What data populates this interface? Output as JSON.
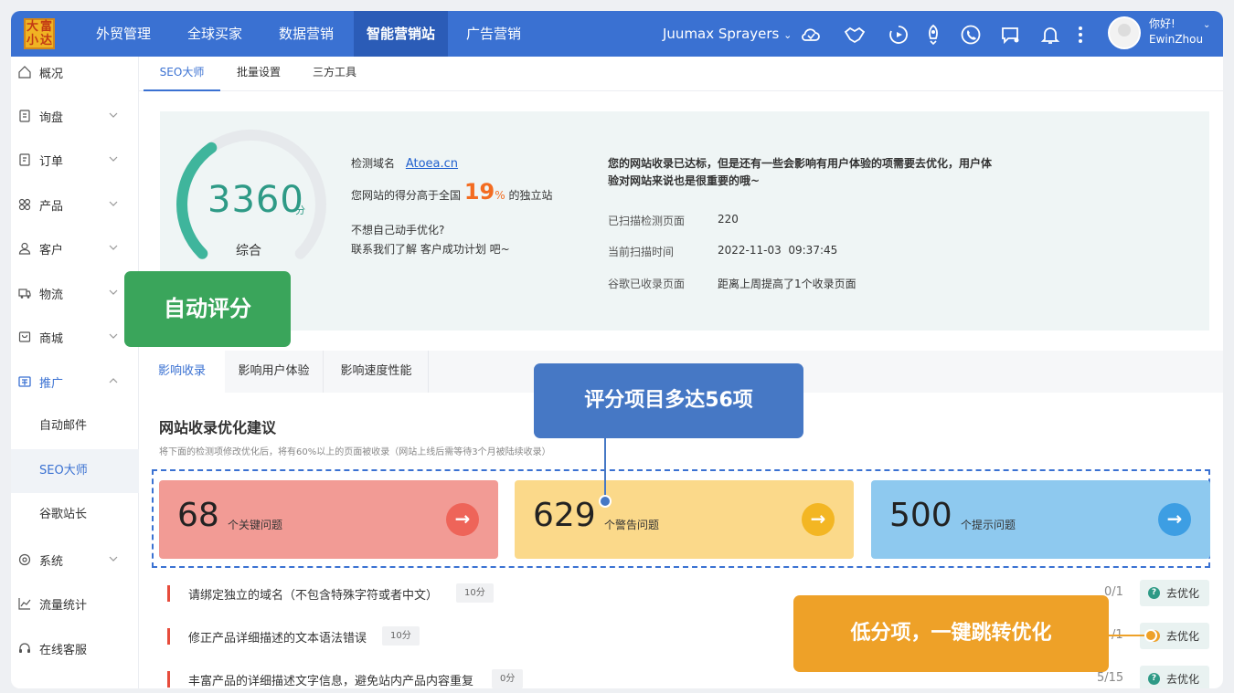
{
  "brand": {
    "logo_chars": [
      "大",
      "富",
      "小",
      "达"
    ]
  },
  "nav": {
    "items": [
      "外贸管理",
      "全球买家",
      "数据营销",
      "智能营销站",
      "广告营销"
    ]
  },
  "header": {
    "company": "Juumax Sprayers",
    "greeting": "你好!",
    "username": "EwinZhou",
    "icons": [
      "cloud-icon",
      "handshake-icon",
      "play-icon",
      "rocket-icon",
      "phone-icon",
      "chat-icon",
      "bell-icon",
      "more-icon"
    ]
  },
  "sidebar": {
    "items": [
      {
        "label": "概况",
        "icon": "home-icon"
      },
      {
        "label": "询盘",
        "icon": "inquiry-icon"
      },
      {
        "label": "订单",
        "icon": "order-icon"
      },
      {
        "label": "产品",
        "icon": "product-icon"
      },
      {
        "label": "客户",
        "icon": "user-icon"
      },
      {
        "label": "物流",
        "icon": "logistics-icon"
      },
      {
        "label": "商城",
        "icon": "shop-icon"
      },
      {
        "label": "推广",
        "icon": "promote-icon"
      },
      {
        "label": "系统",
        "icon": "system-icon"
      },
      {
        "label": "流量统计",
        "icon": "chart-icon"
      },
      {
        "label": "在线客服",
        "icon": "headset-icon"
      }
    ],
    "subitems": [
      "自动邮件",
      "SEO大师",
      "谷歌站长"
    ]
  },
  "tabs_top": [
    "SEO大师",
    "批量设置",
    "三方工具"
  ],
  "score": {
    "value": "3360",
    "unit": "分",
    "caption": "综合",
    "gauge_fraction": 0.37,
    "domain_label": "检测域名",
    "domain": "Atoea.cn",
    "rank_prefix": "您网站的得分高于全国",
    "rank_pct": "19",
    "rank_pct_sign": "%",
    "rank_suffix": "的独立站",
    "cta_line1": "不想自己动手优化?",
    "cta_line2": "联系我们了解 客户成功计划 吧~",
    "summary_line1": "您的网站收录已达标，但是还有一些会影响有用户体验的项需要去优化，用户体",
    "summary_line2": "验对网站来说也是很重要的哦~",
    "stats": [
      {
        "label": "已扫描检测页面",
        "value": "220"
      },
      {
        "label": "当前扫描时间",
        "value": "2022-11-03  09:37:45"
      },
      {
        "label": "谷歌已收录页面",
        "value": "距离上周提高了1个收录页面"
      }
    ]
  },
  "tabs_section": [
    "影响收录",
    "影响用户体验",
    "影响速度性能"
  ],
  "section": {
    "title": "网站收录优化建议",
    "subtitle": "将下面的检测项修改优化后，将有60%以上的页面被收录（网站上线后需等待3个月被陆续收录）"
  },
  "cards": [
    {
      "num": "68",
      "label": "个关键问题",
      "color": "#f29b95",
      "arrow_color": "#ee6459"
    },
    {
      "num": "629",
      "label": "个警告问题",
      "color": "#fbd98a",
      "arrow_color": "#f3b623"
    },
    {
      "num": "500",
      "label": "个提示问题",
      "color": "#8ec9ef",
      "arrow_color": "#3d9ee3"
    }
  ],
  "issues": [
    {
      "text": "请绑定独立的域名（不包含特殊字符或者中文）",
      "badge": "10分",
      "frac": "0/1",
      "action": "去优化"
    },
    {
      "text": "修正产品详细描述的文本语法错误",
      "badge": "10分",
      "frac": "/1",
      "action": "去优化"
    },
    {
      "text": "丰富产品的详细描述文字信息，避免站内产品内容重复",
      "badge": "0分",
      "frac": "5/15",
      "action": "去优化"
    }
  ],
  "callouts": {
    "auto_score": "自动评分",
    "item_count": "评分项目多达56项",
    "low_score": "低分项，一键跳转优化"
  },
  "colors": {
    "primary": "#3a71d2",
    "accent_green": "#2e9a86",
    "callout_green": "#3aa55b",
    "callout_blue": "#4678c5",
    "callout_orange": "#eea128"
  }
}
